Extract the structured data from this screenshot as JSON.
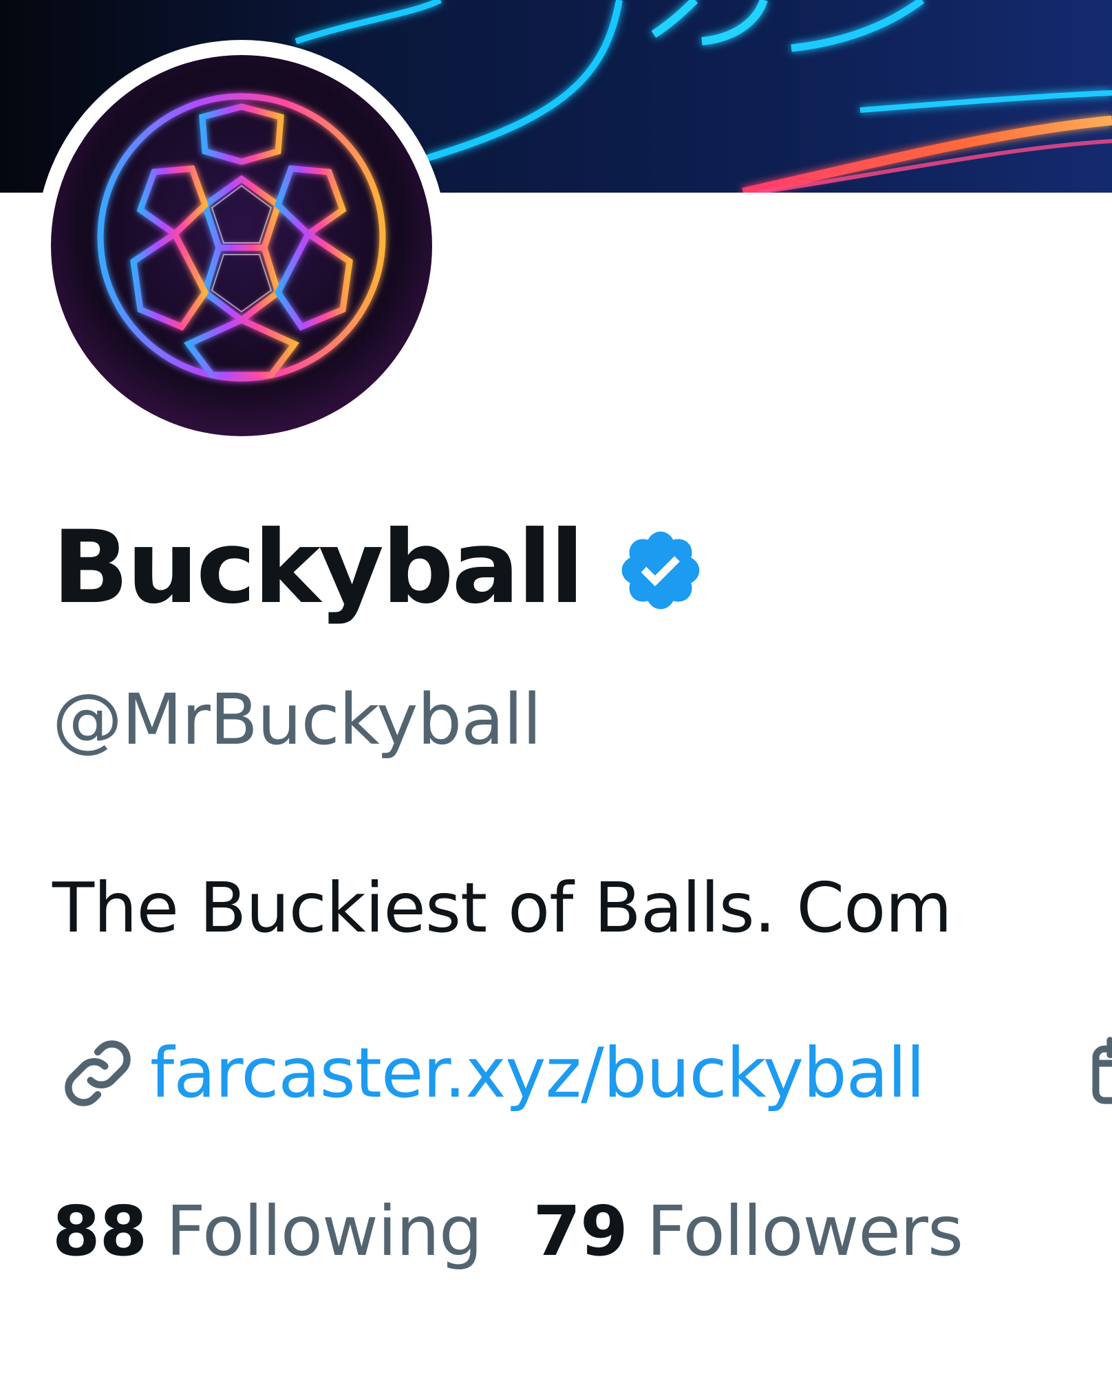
{
  "profile": {
    "display_name": "Buckyball",
    "verified": true,
    "handle": "@MrBuckyball",
    "bio": "The Buckiest of Balls. Com",
    "website": "farcaster.xyz/buckyball",
    "following_count": "88",
    "following_label": "Following",
    "followers_count": "79",
    "followers_label": "Followers"
  },
  "icons": {
    "verified": "verified-badge-icon",
    "link": "link-icon",
    "calendar": "calendar-icon"
  },
  "colors": {
    "text_primary": "#0f1419",
    "text_secondary": "#536471",
    "accent": "#1d9bf0",
    "background": "#ffffff"
  }
}
